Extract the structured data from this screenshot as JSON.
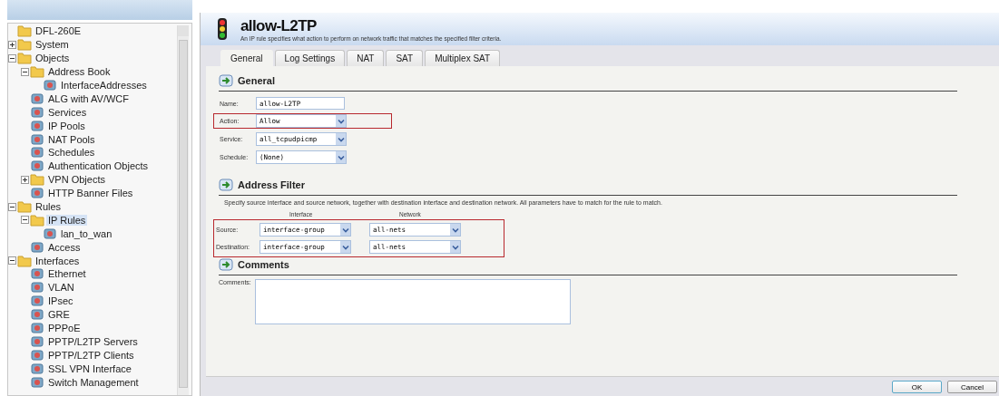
{
  "sidebar": {
    "tree": [
      {
        "label": "DFL-260E",
        "selected": false,
        "children": [
          {
            "label": "System",
            "selected": false,
            "expanded": false
          },
          {
            "label": "Objects",
            "selected": false,
            "expanded": true,
            "children": [
              {
                "label": "Address Book",
                "selected": false,
                "expanded": true,
                "children": [
                  {
                    "label": "InterfaceAddresses",
                    "selected": false
                  }
                ]
              },
              {
                "label": "ALG with AV/WCF",
                "selected": false
              },
              {
                "label": "Services",
                "selected": false
              },
              {
                "label": "IP Pools",
                "selected": false
              },
              {
                "label": "NAT Pools",
                "selected": false
              },
              {
                "label": "Schedules",
                "selected": false
              },
              {
                "label": "Authentication Objects",
                "selected": false
              },
              {
                "label": "VPN Objects",
                "selected": false,
                "expanded": false
              },
              {
                "label": "HTTP Banner Files",
                "selected": false
              }
            ]
          },
          {
            "label": "Rules",
            "selected": false,
            "expanded": true,
            "children": [
              {
                "label": "IP Rules",
                "selected": true,
                "expanded": true,
                "children": [
                  {
                    "label": "lan_to_wan",
                    "selected": false
                  }
                ]
              },
              {
                "label": "Access",
                "selected": false
              }
            ]
          },
          {
            "label": "Interfaces",
            "selected": false,
            "expanded": true,
            "children": [
              {
                "label": "Ethernet",
                "selected": false
              },
              {
                "label": "VLAN",
                "selected": false
              },
              {
                "label": "IPsec",
                "selected": false
              },
              {
                "label": "GRE",
                "selected": false
              },
              {
                "label": "PPPoE",
                "selected": false
              },
              {
                "label": "PPTP/L2TP Servers",
                "selected": false
              },
              {
                "label": "PPTP/L2TP Clients",
                "selected": false
              },
              {
                "label": "SSL VPN Interface",
                "selected": false
              },
              {
                "label": "Switch Management",
                "selected": false
              }
            ]
          }
        ]
      }
    ]
  },
  "header": {
    "title": "allow-L2TP",
    "description": "An IP rule specifies what action to perform on network traffic that matches the specified filter criteria."
  },
  "tabs": [
    {
      "label": "General",
      "selected": true
    },
    {
      "label": "Log Settings",
      "selected": false
    },
    {
      "label": "NAT",
      "selected": false
    },
    {
      "label": "SAT",
      "selected": false
    },
    {
      "label": "Multiplex SAT",
      "selected": false
    }
  ],
  "general": {
    "title": "General",
    "fields": [
      {
        "kind": "text",
        "label": "Name:",
        "value": "allow-L2TP",
        "highlighted": false
      },
      {
        "kind": "select",
        "label": "Action:",
        "value": "Allow",
        "highlighted": true
      },
      {
        "kind": "select",
        "label": "Service:",
        "value": "all_tcpudpicmp",
        "highlighted": false
      },
      {
        "kind": "select",
        "label": "Schedule:",
        "value": "(None)",
        "highlighted": false
      }
    ]
  },
  "address_filter": {
    "title": "Address Filter",
    "description": "Specify source interface and source network, together with destination interface and destination network. All parameters have to match for the rule to match.",
    "columns": [
      "Interface",
      "Network"
    ],
    "highlighted": true,
    "rows": [
      {
        "label": "Source:",
        "interface": "interface-group",
        "network": "all-nets"
      },
      {
        "label": "Destination:",
        "interface": "interface-group",
        "network": "all-nets"
      }
    ]
  },
  "comments": {
    "title": "Comments",
    "label": "Comments:"
  },
  "buttons": [
    {
      "label": "OK",
      "default": true
    },
    {
      "label": "Cancel",
      "default": false
    }
  ]
}
